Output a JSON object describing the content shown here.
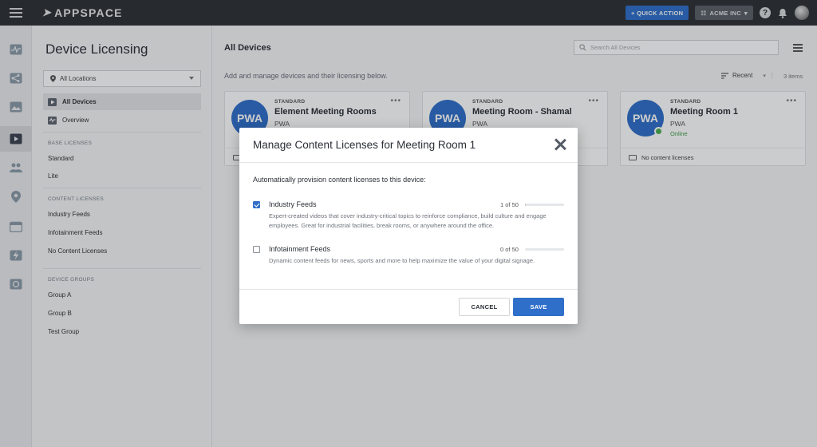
{
  "topbar": {
    "brand": "APPSPACE",
    "quick_action": "+ QUICK ACTION",
    "account": "ACME INC",
    "icons": [
      "menu-icon",
      "help-icon",
      "bell-icon",
      "avatar"
    ]
  },
  "rail": {
    "icons": [
      "activity-icon",
      "share-icon",
      "image-icon",
      "play-icon",
      "users-icon",
      "location-icon",
      "calendar-icon",
      "bolt-icon",
      "dashboard-icon"
    ]
  },
  "sidebar": {
    "title": "Device Licensing",
    "location_select": "All Locations",
    "nav": [
      {
        "label": "All Devices",
        "active": true
      },
      {
        "label": "Overview",
        "active": false
      }
    ],
    "base_licenses": {
      "heading": "BASE LICENSES",
      "items": [
        "Standard",
        "Lite"
      ]
    },
    "content_licenses": {
      "heading": "CONTENT LICENSES",
      "items": [
        "Industry Feeds",
        "Infotainment Feeds",
        "No Content Licenses"
      ]
    },
    "device_groups": {
      "heading": "DEVICE GROUPS",
      "items": [
        "Group A",
        "Group B",
        "Test Group"
      ]
    }
  },
  "main": {
    "title": "All Devices",
    "search_placeholder": "Search All Devices",
    "subtitle": "Add and manage devices and their licensing below.",
    "sort_label": "Recent",
    "count": "3 items",
    "cards": [
      {
        "tier": "STANDARD",
        "name": "Element Meeting Rooms",
        "badge": "PWA",
        "type": "PWA",
        "status": "",
        "licenses": ""
      },
      {
        "tier": "STANDARD",
        "name": "Meeting Room - Shamal",
        "badge": "PWA",
        "type": "PWA",
        "status": "",
        "licenses": ""
      },
      {
        "tier": "STANDARD",
        "name": "Meeting Room 1",
        "badge": "PWA",
        "type": "PWA",
        "status": "Online",
        "licenses": "No content licenses"
      }
    ]
  },
  "modal": {
    "title": "Manage Content Licenses for Meeting Room 1",
    "intro": "Automatically provision content licenses to this device:",
    "options": [
      {
        "label": "Industry Feeds",
        "checked": true,
        "count": "1 of 50",
        "used": 1,
        "total": 50,
        "description": "Expert-created videos that cover industry-critical topics to reinforce compliance, build culture and engage employees. Great for industrial facilities, break rooms, or anywhere around the office."
      },
      {
        "label": "Infotainment Feeds",
        "checked": false,
        "count": "0 of 50",
        "used": 0,
        "total": 50,
        "description": "Dynamic content feeds for news, sports and more to help maximize the value of your digital signage."
      }
    ],
    "cancel_label": "CANCEL",
    "save_label": "SAVE"
  },
  "colors": {
    "accent": "#2f6fc9",
    "topbar": "#2e3035",
    "online": "#4caf50"
  }
}
